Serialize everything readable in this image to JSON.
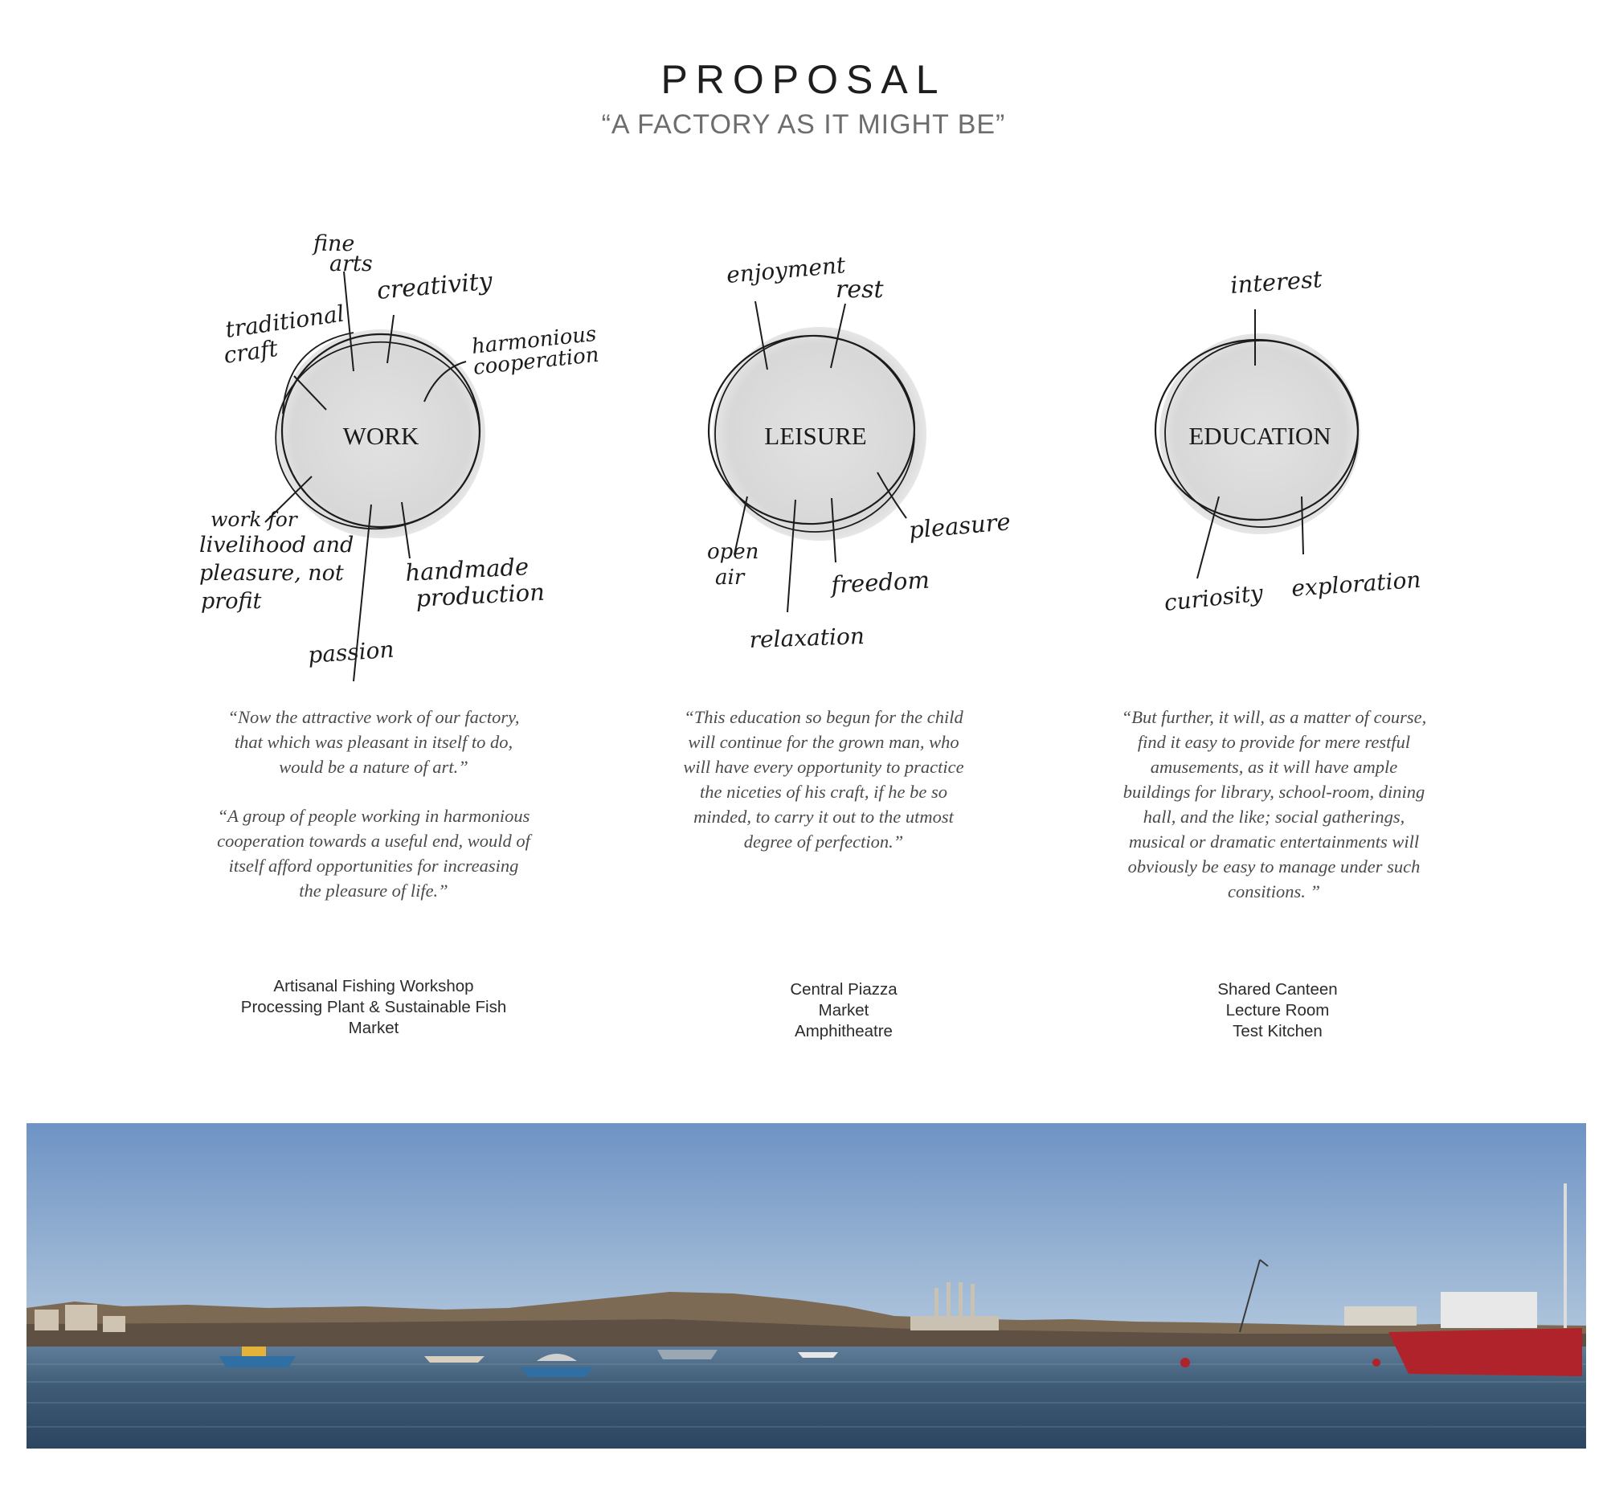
{
  "header": {
    "title": "PROPOSAL",
    "subtitle": "“A FACTORY AS IT MIGHT BE”"
  },
  "diagrams": [
    {
      "concept": "WORK",
      "annotations": [
        "fine arts",
        "creativity",
        "traditional craft",
        "harmonious cooperation",
        "work for livelihood and pleasure, not profit",
        "handmade production",
        "passion"
      ],
      "quotes": [
        "“Now the attractive work of our factory, that which was pleasant in itself to do, would be a nature of art.”",
        "“A group of people working in harmonious cooperation towards a useful end, would of itself afford opportunities for increasing the pleasure of life.”"
      ],
      "program": "Artisanal Fishing Workshop\nProcessing Plant & Sustainable Fish\nMarket"
    },
    {
      "concept": "LEISURE",
      "annotations": [
        "enjoyment",
        "rest",
        "open air",
        "freedom",
        "pleasure",
        "relaxation"
      ],
      "quotes": [
        "“This education so begun for the child will continue for the grown man, who will have every opportunity to practice the niceties of his craft, if he be so minded, to carry it out to the utmost degree of perfection.”"
      ],
      "program": "Central Piazza\nMarket\nAmphitheatre"
    },
    {
      "concept": "EDUCATION",
      "annotations": [
        "interest",
        "curiosity",
        "exploration"
      ],
      "quotes": [
        "“But further, it will, as a matter of course, find it easy to provide for mere restful amusements, as it will have ample buildings for library, school-room, dining hall, and the like; social gatherings, musical or dramatic entertainments will obviously be easy to manage under such consitions. ”"
      ],
      "program": "Shared Canteen\nLecture Room\nTest Kitchen"
    }
  ],
  "colors": {
    "circle_fill": "#dcdcdc",
    "ink": "#1c1c1c",
    "sky_top": "#6e93c4",
    "sky_bottom": "#a9c2dc",
    "water": "#3e5b76",
    "boat_red": "#b0232a"
  }
}
